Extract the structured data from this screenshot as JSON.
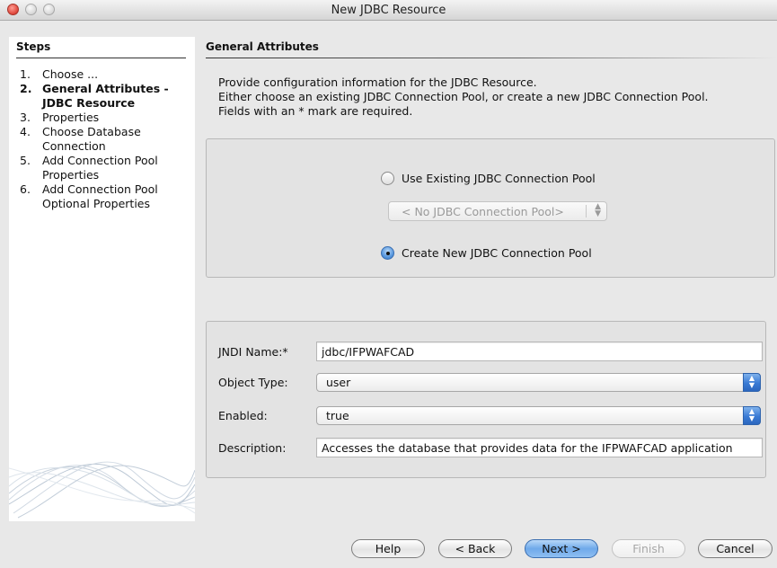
{
  "window": {
    "title": "New JDBC Resource",
    "controls": [
      "close-button",
      "minimize-button",
      "zoom-button"
    ]
  },
  "steps": {
    "header": "Steps",
    "items": [
      {
        "num": "1.",
        "label": "Choose ..."
      },
      {
        "num": "2.",
        "label": "General Attributes - JDBC Resource",
        "active": true
      },
      {
        "num": "3.",
        "label": "Properties"
      },
      {
        "num": "4.",
        "label": "Choose Database Connection"
      },
      {
        "num": "5.",
        "label": "Add Connection Pool Properties"
      },
      {
        "num": "6.",
        "label": "Add Connection Pool Optional Properties"
      }
    ]
  },
  "main": {
    "header": "General Attributes",
    "intro": [
      "Provide configuration information for the JDBC Resource.",
      "Either choose an existing JDBC Connection Pool, or create a new JDBC Connection Pool.",
      "Fields with an * mark are required."
    ],
    "pool_options": {
      "use_existing_label": "Use Existing JDBC Connection Pool",
      "pool_select_value": "< No JDBC Connection Pool>",
      "create_new_label": "Create New JDBC Connection Pool",
      "selected": "create_new"
    },
    "form": {
      "jndi_label": "JNDI Name:*",
      "jndi_value": "jdbc/IFPWAFCAD",
      "object_type_label": "Object Type:",
      "object_type_value": "user",
      "enabled_label": "Enabled:",
      "enabled_value": "true",
      "description_label": "Description:",
      "description_value": "Accesses the database that provides data for the IFPWAFCAD application"
    }
  },
  "buttons": {
    "help": "Help",
    "back": "< Back",
    "next": "Next >",
    "finish": "Finish",
    "cancel": "Cancel"
  },
  "colors": {
    "window_bg": "#e8e8e8",
    "accent_blue": "#3a7bd5",
    "disabled_text": "#a8a8a8"
  }
}
